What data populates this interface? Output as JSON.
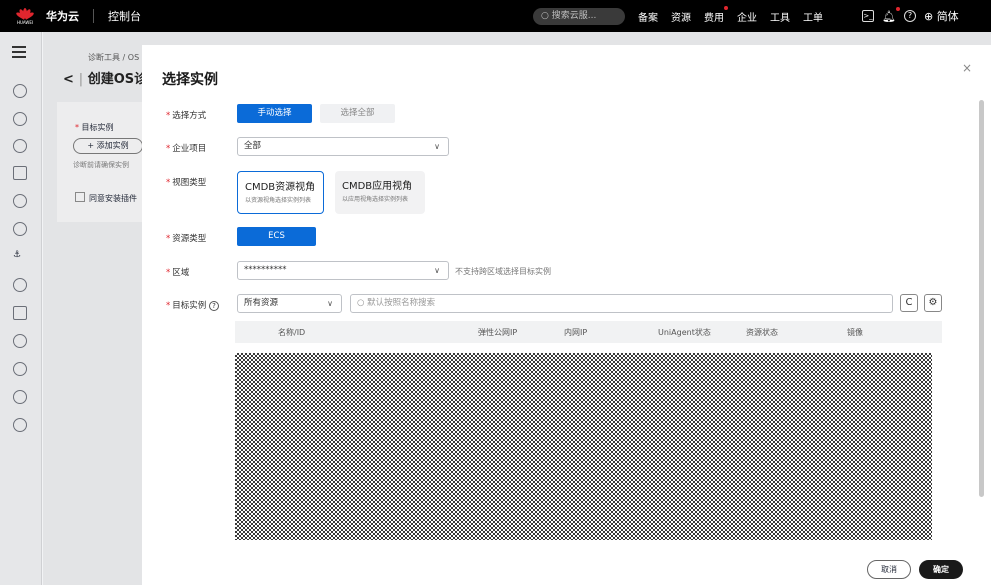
{
  "topbar": {
    "logo_text": "HUAWEI",
    "brand": "华为云",
    "console": "控制台",
    "search_placeholder": "搜索云服...",
    "nav": [
      "备案",
      "资源",
      "费用",
      "企业",
      "工具",
      "工单"
    ],
    "lang": "简体"
  },
  "background": {
    "breadcrumb": "诊断工具 / OS",
    "title": "创建OS诊",
    "target_label": "目标实例",
    "add_instance": "+ 添加实例",
    "hint": "诊断前请确保实例",
    "agree": "同意安装插件"
  },
  "modal": {
    "title": "选择实例",
    "close": "×",
    "select_mode": {
      "label": "选择方式",
      "options": [
        "手动选择",
        "选择全部"
      ],
      "selected": "手动选择"
    },
    "enterprise_project": {
      "label": "企业项目",
      "value": "全部"
    },
    "view_type": {
      "label": "视图类型",
      "options": [
        {
          "title": "CMDB资源视角",
          "sub": "以资源视角选择实例列表",
          "selected": true
        },
        {
          "title": "CMDB应用视角",
          "sub": "以应用视角选择实例列表",
          "selected": false
        }
      ]
    },
    "resource_type": {
      "label": "资源类型",
      "value": "ECS"
    },
    "region": {
      "label": "区域",
      "value": "**********",
      "note": "不支持跨区域选择目标实例"
    },
    "target": {
      "label": "目标实例",
      "help": "?",
      "filter": "所有资源",
      "search_placeholder": "默认按照名称搜索",
      "refresh": "C",
      "settings": "⚙"
    },
    "table": {
      "columns": [
        "名称/ID",
        "弹性公网IP",
        "内网IP",
        "UniAgent状态",
        "资源状态",
        "镜像"
      ]
    },
    "footer": {
      "cancel": "取消",
      "ok": "确定"
    }
  }
}
